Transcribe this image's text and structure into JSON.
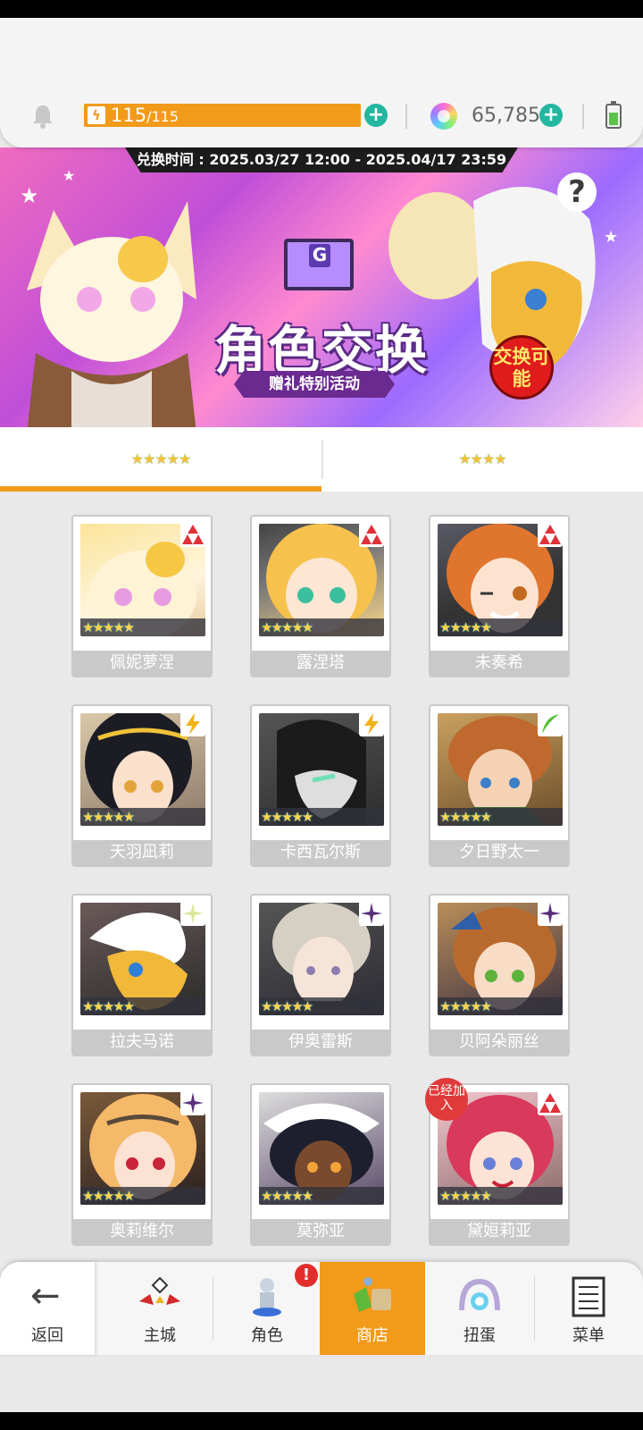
{
  "header": {
    "stamina_current": "115",
    "stamina_max": "/115",
    "gems": "65,785",
    "plus_symbol": "+"
  },
  "banner": {
    "period": "兑换时间 : 2025.03/27 12:00 - 2025.04/17 23:59",
    "title": "角色交换",
    "subtitle": "赠礼特别活动",
    "badge": "交换可能",
    "help": "?"
  },
  "tabs": [
    {
      "label": "★★★★★"
    },
    {
      "label": "★★★★"
    }
  ],
  "characters": [
    {
      "name": "佩妮萝涅",
      "stars": "★★★★★",
      "attribute": "fire"
    },
    {
      "name": "露涅塔",
      "stars": "★★★★★",
      "attribute": "fire"
    },
    {
      "name": "未奏希",
      "stars": "★★★★★",
      "attribute": "fire"
    },
    {
      "name": "天羽凪莉",
      "stars": "★★★★★",
      "attribute": "thunder"
    },
    {
      "name": "卡西瓦尔斯",
      "stars": "★★★★★",
      "attribute": "thunder"
    },
    {
      "name": "夕日野太一",
      "stars": "★★★★★",
      "attribute": "wind"
    },
    {
      "name": "拉夫马诺",
      "stars": "★★★★★",
      "attribute": "light"
    },
    {
      "name": "伊奥雷斯",
      "stars": "★★★★★",
      "attribute": "dark"
    },
    {
      "name": "贝阿朵丽丝",
      "stars": "★★★★★",
      "attribute": "dark"
    },
    {
      "name": "奥莉维尔",
      "stars": "★★★★★",
      "attribute": "dark"
    },
    {
      "name": "莫弥亚",
      "stars": "★★★★★",
      "attribute": "dark"
    },
    {
      "name": "黛姮莉亚",
      "stars": "★★★★★",
      "attribute": "fire",
      "badge": "已经加入"
    }
  ],
  "nav": {
    "back": "返回",
    "castle": "主城",
    "character": "角色",
    "shop": "商店",
    "gacha": "扭蛋",
    "menu": "菜单",
    "notif": "!"
  },
  "colors": {
    "accent": "#f29a1a",
    "plus": "#23b7a0",
    "fire": "#e0313a",
    "thunder": "#f2b21a",
    "wind": "#5bbd3b",
    "dark": "#6b3a8f",
    "light": "#d9e89a"
  }
}
